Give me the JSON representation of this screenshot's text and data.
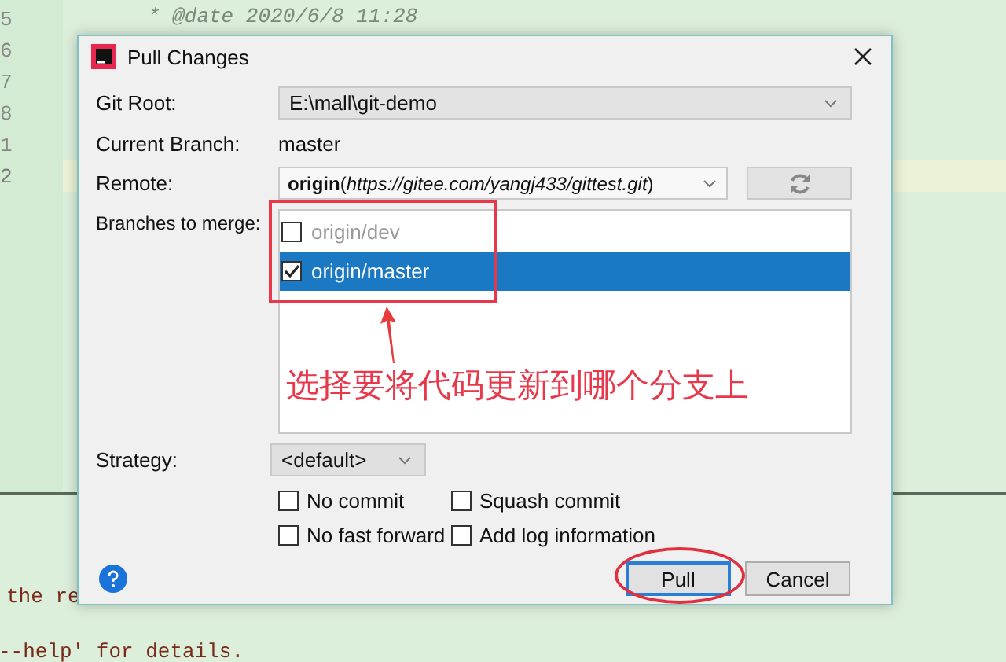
{
  "editor": {
    "lines": [
      {
        "number": "5",
        "current": false
      },
      {
        "number": "6",
        "current": false
      },
      {
        "number": "7",
        "current": false
      },
      {
        "number": "8",
        "current": false
      },
      {
        "number": "1",
        "current": false
      },
      {
        "number": "2",
        "current": true
      }
    ],
    "code_lines": [
      "* @date 2020/6/8 11:28"
    ]
  },
  "console": {
    "lines": [
      "the re",
      "--help' for details."
    ]
  },
  "dialog": {
    "title": "Pull Changes",
    "git_root": {
      "label": "Git Root:",
      "value": "E:\\mall\\git-demo"
    },
    "current_branch": {
      "label": "Current Branch:",
      "value": "master"
    },
    "remote": {
      "label": "Remote:",
      "value": "**origin**(*https://gitee.com/yangj433/gittest.git*)"
    },
    "branches": {
      "label": "Branches to merge:",
      "items": [
        {
          "label": "origin/dev",
          "checked": false,
          "selected": false
        },
        {
          "label": "origin/master",
          "checked": true,
          "selected": true
        }
      ]
    },
    "annotation": {
      "text": "选择要将代码更新到哪个分支上"
    },
    "strategy": {
      "label": "Strategy:",
      "value": "<default>"
    },
    "options": [
      {
        "label": "No commit",
        "checked": false
      },
      {
        "label": "Squash commit",
        "checked": false
      },
      {
        "label": "No fast forward",
        "checked": false
      },
      {
        "label": "Add log information",
        "checked": false
      }
    ],
    "buttons": [
      {
        "label": "Pull",
        "default": true
      },
      {
        "label": "Cancel",
        "default": false
      }
    ]
  }
}
